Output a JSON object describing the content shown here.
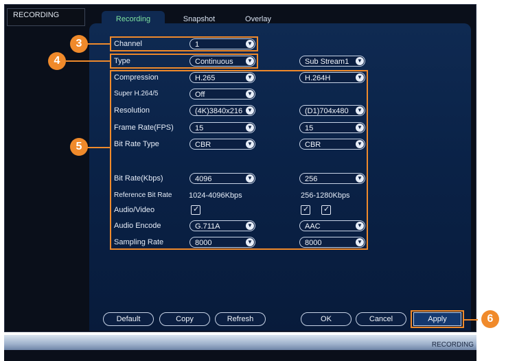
{
  "window": {
    "title": "RECORDING",
    "footer_label": "RECORDING"
  },
  "tabs": [
    {
      "label": "Recording",
      "active": true
    },
    {
      "label": "Snapshot",
      "active": false
    },
    {
      "label": "Overlay",
      "active": false
    }
  ],
  "form": {
    "channel": {
      "label": "Channel",
      "value": "1"
    },
    "type": {
      "label": "Type",
      "value": "Continuous"
    },
    "sub_stream": {
      "value": "Sub Stream1"
    },
    "compression": {
      "label": "Compression",
      "main": "H.265",
      "sub": "H.264H"
    },
    "super_h": {
      "label": "Super H.264/5",
      "main": "Off"
    },
    "resolution": {
      "label": "Resolution",
      "main": "(4K)3840x216",
      "sub": "(D1)704x480"
    },
    "frame_rate": {
      "label": "Frame Rate(FPS)",
      "main": "15",
      "sub": "15"
    },
    "bit_rate_type": {
      "label": "Bit Rate Type",
      "main": "CBR",
      "sub": "CBR"
    },
    "bit_rate": {
      "label": "Bit Rate(Kbps)",
      "main": "4096",
      "sub": "256"
    },
    "reference_bit_rate": {
      "label": "Reference Bit Rate",
      "main": "1024-4096Kbps",
      "sub": "256-1280Kbps"
    },
    "audio_video": {
      "label": "Audio/Video",
      "main_checked": true,
      "sub_audio_checked": true,
      "sub_video_checked": true
    },
    "audio_encode": {
      "label": "Audio Encode",
      "main": "G.711A",
      "sub": "AAC"
    },
    "sampling_rate": {
      "label": "Sampling Rate",
      "main": "8000",
      "sub": "8000"
    }
  },
  "buttons": {
    "default": "Default",
    "copy": "Copy",
    "refresh": "Refresh",
    "ok": "OK",
    "cancel": "Cancel",
    "apply": "Apply"
  },
  "callouts": [
    "3",
    "4",
    "5",
    "6"
  ],
  "colors": {
    "callout": "#f08a2b",
    "panel": "#0a2247",
    "active_tab_text": "#7fe3a0"
  }
}
